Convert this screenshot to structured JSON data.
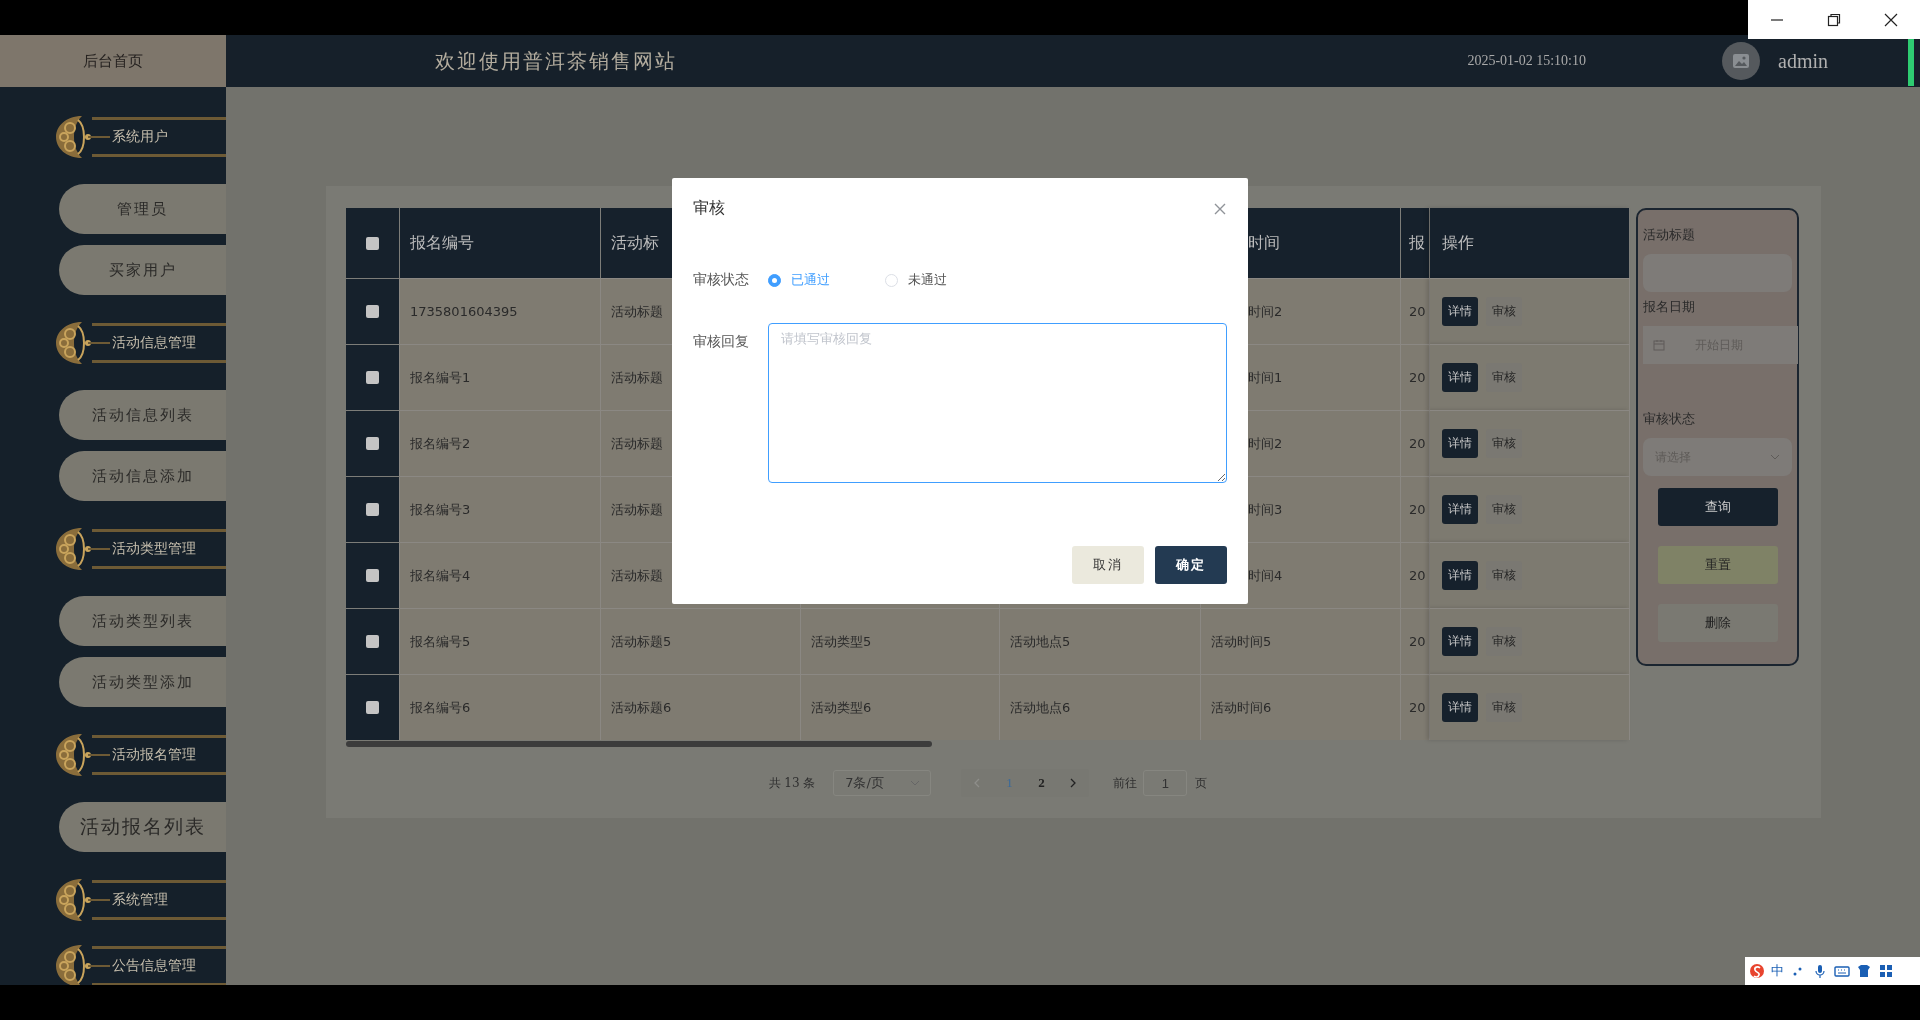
{
  "header": {
    "home_label": "后台首页",
    "title": "欢迎使用普洱茶销售网站",
    "datetime": "2025-01-02 15:10:10",
    "user": "admin"
  },
  "menu": [
    {
      "label": "系统用户",
      "children": [
        {
          "label": "管理员",
          "selected": false
        },
        {
          "label": "买家用户",
          "selected": false
        }
      ]
    },
    {
      "label": "活动信息管理",
      "children": [
        {
          "label": "活动信息列表",
          "selected": false
        },
        {
          "label": "活动信息添加",
          "selected": false
        }
      ]
    },
    {
      "label": "活动类型管理",
      "children": [
        {
          "label": "活动类型列表",
          "selected": false
        },
        {
          "label": "活动类型添加",
          "selected": false
        }
      ]
    },
    {
      "label": "活动报名管理",
      "children": [
        {
          "label": "活动报名列表",
          "selected": true
        }
      ]
    },
    {
      "label": "系统管理"
    },
    {
      "label": "公告信息管理"
    }
  ],
  "table": {
    "select_all_checked": false,
    "columns": {
      "registration_no": "报名编号",
      "title": "活动标",
      "time": "时间",
      "column_6": "报",
      "actions": "操作"
    },
    "rows": [
      {
        "checked": false,
        "registration_no": "1735801604395",
        "title": "活动标题",
        "time": "时间2",
        "column_6": "20",
        "actions": [
          "详情",
          "审核"
        ]
      },
      {
        "checked": false,
        "registration_no": "报名编号1",
        "title": "活动标题",
        "time": "时间1",
        "column_6": "20",
        "actions": [
          "详情",
          "审核"
        ]
      },
      {
        "checked": false,
        "registration_no": "报名编号2",
        "title": "活动标题",
        "time": "时间2",
        "column_6": "20",
        "actions": [
          "详情",
          "审核"
        ]
      },
      {
        "checked": false,
        "registration_no": "报名编号3",
        "title": "活动标题",
        "time": "时间3",
        "column_6": "20",
        "actions": [
          "详情",
          "审核"
        ]
      },
      {
        "checked": false,
        "registration_no": "报名编号4",
        "title": "活动标题",
        "time": "时间4",
        "column_6": "20",
        "actions": [
          "详情",
          "审核"
        ]
      },
      {
        "checked": false,
        "registration_no": "报名编号5",
        "title": "活动标题5",
        "type": "活动类型5",
        "location": "活动地点5",
        "time": "活动时间5",
        "column_6": "20",
        "actions": [
          "详情",
          "审核"
        ]
      },
      {
        "checked": false,
        "registration_no": "报名编号6",
        "title": "活动标题6",
        "type": "活动类型6",
        "location": "活动地点6",
        "time": "活动时间6",
        "column_6": "20",
        "actions": [
          "详情",
          "审核"
        ]
      }
    ]
  },
  "pagination": {
    "total": "共 13 条",
    "page_size": "7条/页",
    "prev_disabled": true,
    "pages": [
      {
        "label": "1",
        "selected": true
      },
      {
        "label": "2",
        "selected": false
      }
    ],
    "goto_label": "前往",
    "goto_value": "1",
    "page_suffix": "页"
  },
  "filters": {
    "fields": [
      {
        "kind": "text",
        "label": "活动标题"
      },
      {
        "kind": "date",
        "label": "报名日期",
        "placeholder": "开始日期"
      },
      {
        "kind": "select",
        "label": "审核状态",
        "placeholder": "请选择"
      }
    ],
    "buttons": [
      {
        "label": "查询",
        "kind": "primary"
      },
      {
        "label": "重置",
        "kind": "warning"
      },
      {
        "label": "删除",
        "kind": "default"
      }
    ]
  },
  "dialog": {
    "title": "审核",
    "status_label": "审核状态",
    "options": [
      {
        "label": "已通过",
        "selected": true
      },
      {
        "label": "未通过",
        "selected": false
      }
    ],
    "reply_label": "审核回复",
    "reply": {
      "placeholder": "请填写审核回复"
    },
    "buttons": [
      {
        "label": "取消",
        "kind": "default"
      },
      {
        "label": "确定",
        "kind": "primary"
      }
    ]
  },
  "ime_toolbar": {
    "mode": "中"
  }
}
